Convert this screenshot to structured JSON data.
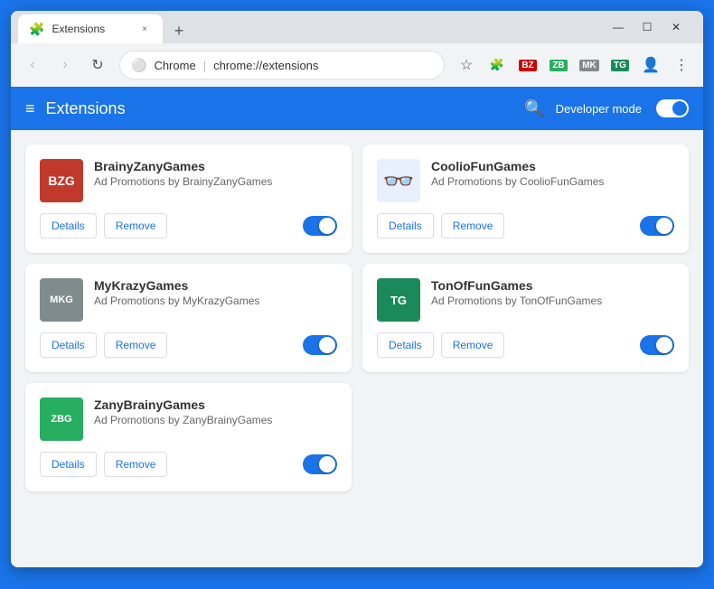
{
  "browser": {
    "tab_title": "Extensions",
    "tab_close": "×",
    "new_tab": "+",
    "nav_back": "‹",
    "nav_forward": "›",
    "nav_reload": "↻",
    "url_provider": "Chrome",
    "url_path": "chrome://extensions",
    "url_separator": "|",
    "bookmark_icon": "☆",
    "account_icon": "👤",
    "menu_icon": "⋮"
  },
  "extensions_page": {
    "menu_icon": "≡",
    "title": "Extensions",
    "search_icon": "🔍",
    "dev_mode_label": "Developer mode",
    "extensions": [
      {
        "id": "brainy-zany-games",
        "name": "BrainyZanyGames",
        "description": "Ad Promotions by BrainyZanyGames",
        "logo_text": "BZG",
        "logo_class": "logo-bzg",
        "details_label": "Details",
        "remove_label": "Remove",
        "enabled": true
      },
      {
        "id": "coolio-fun-games",
        "name": "CoolioFunGames",
        "description": "Ad Promotions by CoolioFunGames",
        "logo_text": "👓",
        "logo_class": "logo-coolioFun",
        "details_label": "Details",
        "remove_label": "Remove",
        "enabled": true
      },
      {
        "id": "my-krazy-games",
        "name": "MyKrazyGames",
        "description": "Ad Promotions by MyKrazyGames",
        "logo_text": "MKG",
        "logo_class": "logo-mkz",
        "details_label": "Details",
        "remove_label": "Remove",
        "enabled": true
      },
      {
        "id": "ton-of-fun-games",
        "name": "TonOfFunGames",
        "description": "Ad Promotions by TonOfFunGames",
        "logo_text": "TG",
        "logo_class": "logo-tonofFun",
        "details_label": "Details",
        "remove_label": "Remove",
        "enabled": true
      },
      {
        "id": "zany-brainy-games",
        "name": "ZanyBrainyGames",
        "description": "Ad Promotions by ZanyBrainyGames",
        "logo_text": "ZBG",
        "logo_class": "logo-zbg",
        "details_label": "Details",
        "remove_label": "Remove",
        "enabled": true
      }
    ]
  }
}
